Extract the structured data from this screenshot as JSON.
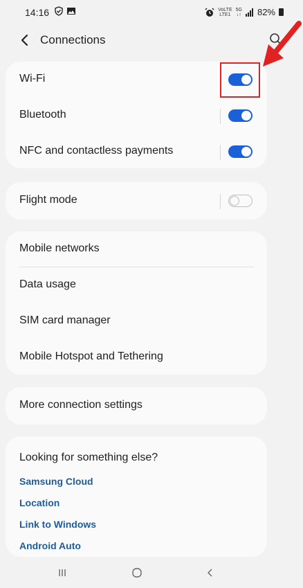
{
  "status": {
    "time": "14:16",
    "network_top": "VoLTE",
    "network_bottom": "LTE1",
    "fiveg_top": "5G",
    "fiveg_bottom": "↓↑",
    "battery": "82%"
  },
  "header": {
    "title": "Connections"
  },
  "wireless": [
    {
      "label": "Wi-Fi",
      "enabled": true
    },
    {
      "label": "Bluetooth",
      "enabled": true
    },
    {
      "label": "NFC and contactless payments",
      "enabled": true
    }
  ],
  "flight": {
    "label": "Flight mode",
    "enabled": false
  },
  "mobile": [
    {
      "label": "Mobile networks"
    },
    {
      "label": "Data usage"
    },
    {
      "label": "SIM card manager"
    },
    {
      "label": "Mobile Hotspot and Tethering"
    }
  ],
  "more": {
    "label": "More connection settings"
  },
  "suggestions": {
    "title": "Looking for something else?",
    "links": [
      "Samsung Cloud",
      "Location",
      "Link to Windows",
      "Android Auto"
    ]
  },
  "colors": {
    "accent": "#1a61d7",
    "link": "#1d5d9b",
    "annotation": "#e02222"
  },
  "icons": {
    "back": "chevron-left-icon",
    "search": "search-icon",
    "recents": "recents-icon",
    "home": "home-icon",
    "nav_back": "nav-back-icon"
  }
}
